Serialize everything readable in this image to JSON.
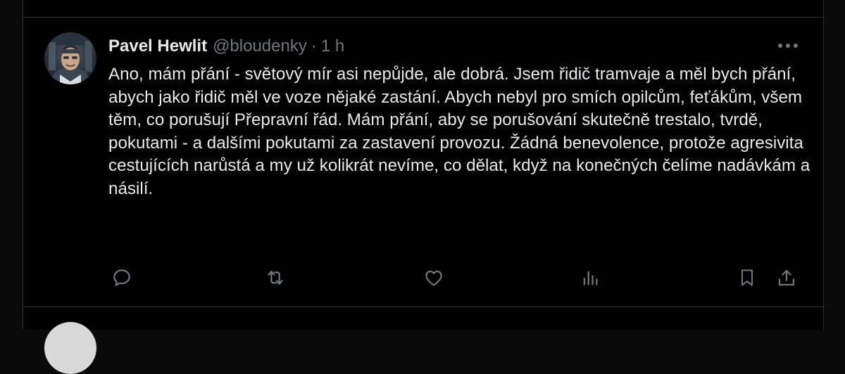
{
  "theme": {
    "background": "#000000",
    "text": "#e7e9ea",
    "secondary_text": "#71767b",
    "border": "#2f3336"
  },
  "tweet": {
    "author_name": "Pavel Hewlit",
    "author_handle": "@bloudenky",
    "separator": "·",
    "time": "1 h",
    "avatar_icon": "user-avatar",
    "text": "Ano, mám přání - světový mír asi nepůjde, ale dobrá. Jsem řidič tramvaje a měl bych přání, abych jako řidič měl ve voze nějaké zastání. Abych nebyl pro smích opilcům, feťákům, všem těm, co porušují Přepravní řád. Mám přání, aby se porušování skutečně trestalo, tvrdě, pokutami - a dalšími pokutami za zastavení provozu. Žádná benevolence, protože agresivita cestujících narůstá a my už kolikrát nevíme, co dělat, když na konečných čelíme nadávkám a násilí."
  },
  "actions": [
    {
      "name": "reply",
      "icon": "reply-icon"
    },
    {
      "name": "repost",
      "icon": "repost-icon"
    },
    {
      "name": "like",
      "icon": "heart-icon"
    },
    {
      "name": "views",
      "icon": "views-icon"
    },
    {
      "name": "bookmark",
      "icon": "bookmark-icon"
    },
    {
      "name": "share",
      "icon": "share-icon"
    }
  ],
  "more_icon": "more-horizontal-icon"
}
